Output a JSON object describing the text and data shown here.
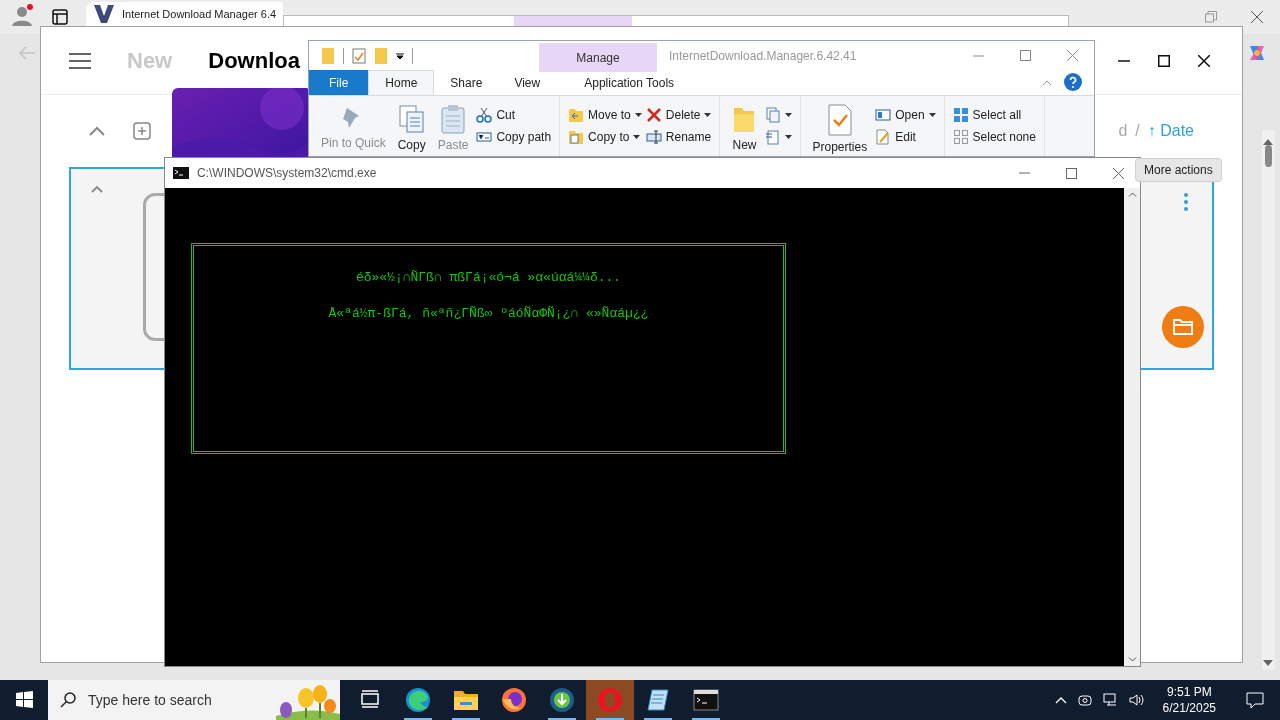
{
  "browser": {
    "tab_title": "Internet Download Manager 6.4"
  },
  "app": {
    "nav": [
      {
        "label": "New",
        "selected": false
      },
      {
        "label": "Downloa",
        "selected": true
      }
    ],
    "sort": {
      "field": "d",
      "separator": "/",
      "order": "↑ Date"
    }
  },
  "explorer": {
    "title": "InternetDownload.Manager.6.42.41",
    "context_tab": "Manage",
    "tabs": [
      {
        "label": "File",
        "kind": "file",
        "selected": false
      },
      {
        "label": "Home",
        "kind": "tab",
        "selected": true
      },
      {
        "label": "Share",
        "kind": "tab",
        "selected": false
      },
      {
        "label": "View",
        "kind": "tab",
        "selected": false
      },
      {
        "label": "Application Tools",
        "kind": "context",
        "selected": false
      }
    ],
    "groups": [
      [
        {
          "kind": "large",
          "label": "Pin to Quick",
          "disabled": true
        },
        {
          "kind": "large",
          "label": "Copy",
          "disabled": false
        },
        {
          "kind": "large",
          "label": "Paste",
          "disabled": true
        },
        {
          "kind": "stack",
          "items": [
            {
              "label": "Cut",
              "dropdown": false,
              "disabled": false
            },
            {
              "label": "Copy path",
              "dropdown": false,
              "disabled": false
            }
          ]
        }
      ],
      [
        {
          "kind": "stack",
          "items": [
            {
              "label": "Move to",
              "dropdown": true,
              "disabled": false
            },
            {
              "label": "Copy to",
              "dropdown": true,
              "disabled": false
            }
          ]
        },
        {
          "kind": "stack",
          "items": [
            {
              "label": "Delete",
              "dropdown": true,
              "disabled": false
            },
            {
              "label": "Rename",
              "dropdown": false,
              "disabled": false
            }
          ]
        }
      ],
      [
        {
          "kind": "large",
          "label": "New",
          "disabled": false
        },
        {
          "kind": "stack",
          "items": [
            {
              "dropdown": true,
              "disabled": false
            },
            {
              "dropdown": true,
              "disabled": false
            }
          ]
        }
      ],
      [
        {
          "kind": "large",
          "label": "Properties",
          "disabled": false
        },
        {
          "kind": "stack",
          "items": [
            {
              "label": "Open",
              "dropdown": true,
              "disabled": false
            },
            {
              "label": "Edit",
              "dropdown": false,
              "disabled": false
            }
          ]
        }
      ],
      [
        {
          "kind": "stack",
          "items": [
            {
              "label": "Select all",
              "dropdown": false,
              "disabled": false
            },
            {
              "label": "Select none",
              "dropdown": false,
              "disabled": false
            }
          ]
        }
      ]
    ]
  },
  "cmd": {
    "title": "C:\\WINDOWS\\system32\\cmd.exe",
    "lines": [
      "éδ»«½¡∩ÑΓß∩ πßΓá¡«ó¬á »α«úαá¼¼δ...",
      "Å«ªá½π-ßΓá, ñ«ªñ¿ΓÑß∞ ºáóÑαΦÑ¡¿∩ «»Ñαáµ¿¿"
    ]
  },
  "tooltip": "More actions",
  "taskbar": {
    "search": {
      "placeholder": "Type here to search"
    },
    "apps": [
      {
        "kind": "taskview",
        "running": false,
        "selected": false
      },
      {
        "kind": "edge",
        "running": true,
        "selected": false
      },
      {
        "kind": "explorer",
        "running": true,
        "selected": false
      },
      {
        "kind": "firefox",
        "running": false,
        "selected": false
      },
      {
        "kind": "idm",
        "running": true,
        "selected": false
      },
      {
        "kind": "opera",
        "running": true,
        "selected": true
      },
      {
        "kind": "notepad",
        "running": true,
        "selected": false
      },
      {
        "kind": "cmd",
        "running": true,
        "selected": false
      }
    ],
    "time": "9:51 PM",
    "date": "6/21/2025"
  }
}
